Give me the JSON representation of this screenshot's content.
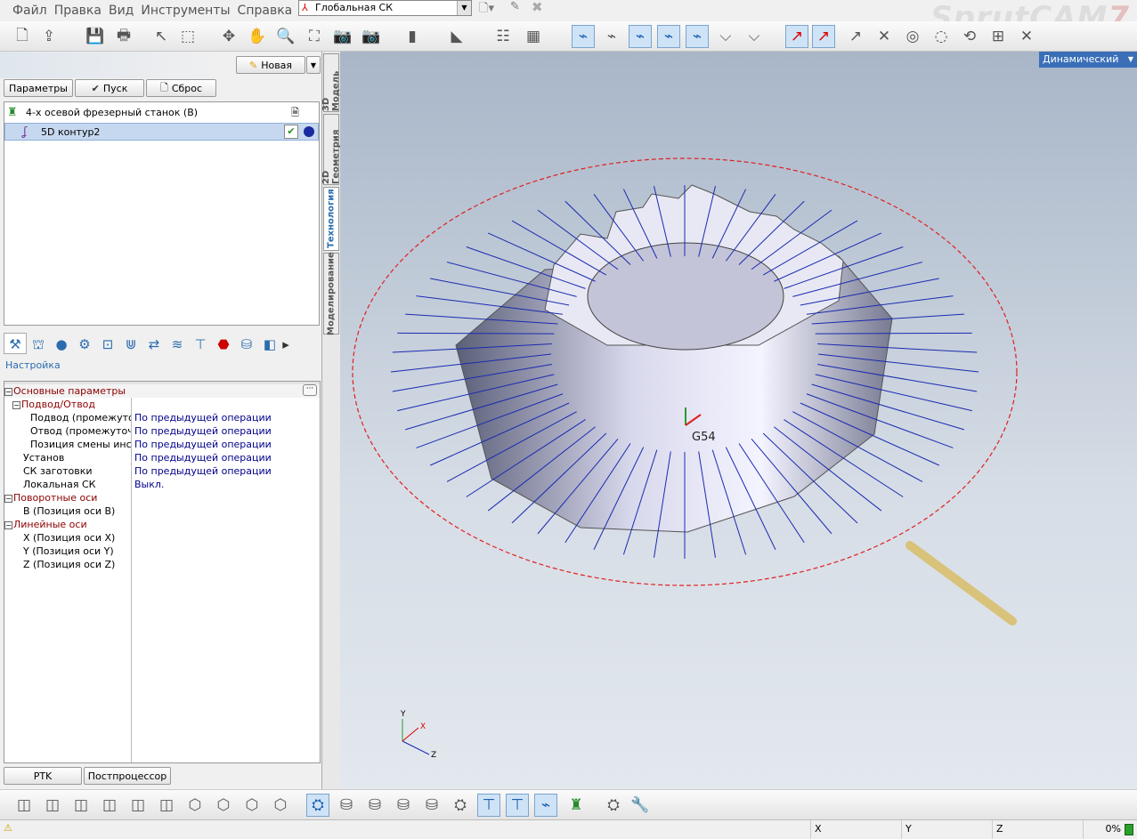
{
  "menu": [
    "Файл",
    "Правка",
    "Вид",
    "Инструменты",
    "Справка"
  ],
  "coordinate_system": "Глобальная СК",
  "logo": "SprutCAM 7",
  "left": {
    "new_button": "Новая",
    "tabs": [
      "Параметры",
      "Пуск",
      "Сброс"
    ],
    "tree": [
      {
        "label": "4-х осевой фрезерный станок (B)"
      },
      {
        "label": "5D контур2"
      }
    ],
    "section_label": "Настройка",
    "properties": [
      {
        "name": "Основные параметры",
        "value": "",
        "level": 0,
        "group": true
      },
      {
        "name": "Подвод/Отвод",
        "value": "",
        "level": 1,
        "group": true
      },
      {
        "name": "Подвод (промежуточн",
        "value": "По предыдущей операции",
        "level": 2
      },
      {
        "name": "Отвод (промежуточны",
        "value": "По предыдущей операции",
        "level": 2
      },
      {
        "name": "Позиция смены инстру",
        "value": "По предыдущей операции",
        "level": 2
      },
      {
        "name": "Установ",
        "value": "По предыдущей операции",
        "level": 1
      },
      {
        "name": "СК заготовки",
        "value": "По предыдущей операции",
        "level": 1
      },
      {
        "name": "Локальная СК",
        "value": "Выкл.",
        "level": 1
      },
      {
        "name": "Поворотные оси",
        "value": "",
        "level": 0,
        "group": true
      },
      {
        "name": "B (Позиция оси B)",
        "value": "",
        "level": 1
      },
      {
        "name": "Линейные оси",
        "value": "",
        "level": 0,
        "group": true
      },
      {
        "name": "X (Позиция оси X)",
        "value": "",
        "level": 1
      },
      {
        "name": "Y (Позиция оси Y)",
        "value": "",
        "level": 1
      },
      {
        "name": "Z (Позиция оси Z)",
        "value": "",
        "level": 1
      }
    ],
    "bottom_tabs": [
      "PTK",
      "Постпроцессор"
    ]
  },
  "vertical_tabs": [
    "3D Модель",
    "2D Геометрия",
    "Технология",
    "Моделирование"
  ],
  "viewport": {
    "mode": "Динамический",
    "origin_label": "G54",
    "axes": {
      "x": "X",
      "y": "Y",
      "z": "Z"
    }
  },
  "status": {
    "x": "X",
    "y": "Y",
    "z": "Z",
    "progress": "0%"
  }
}
